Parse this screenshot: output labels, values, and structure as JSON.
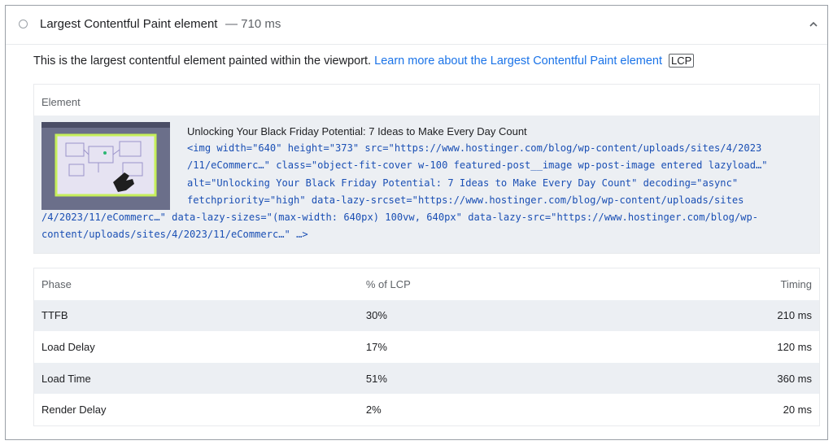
{
  "audit": {
    "title": "Largest Contentful Paint element",
    "value": "— 710 ms",
    "description_text": "This is the largest contentful element painted within the viewport.",
    "learn_more_link": "Learn more about the Largest Contentful Paint element",
    "badge": "LCP"
  },
  "element_table": {
    "header": "Element",
    "node_label": "Unlocking Your Black Friday Potential: 7 Ideas to Make Every Day Count",
    "snippet_lines": [
      "<img width=\"640\" height=\"373\" src=\"https://www.hostinger.com/blog/wp-content/uploads/sites/4/2023",
      "/11/eCommerc…\" class=\"object-fit-cover w-100 featured-post__image wp-post-image entered lazyload…\"",
      "alt=\"Unlocking Your Black Friday Potential: 7 Ideas to Make Every Day Count\" decoding=\"async\"",
      "fetchpriority=\"high\" data-lazy-srcset=\"https://www.hostinger.com/blog/wp-content/uploads/sites",
      "/4/2023/11/eCommerc…\" data-lazy-sizes=\"(max-width: 640px) 100vw, 640px\" data-lazy-src=\"https://www.hostinger.com/blog/wp-",
      "content/uploads/sites/4/2023/11/eCommerc…\" …>"
    ]
  },
  "phase_table": {
    "headers": [
      "Phase",
      "% of LCP",
      "Timing"
    ],
    "rows": [
      [
        "TTFB",
        "30%",
        "210 ms"
      ],
      [
        "Load Delay",
        "17%",
        "120 ms"
      ],
      [
        "Load Time",
        "51%",
        "360 ms"
      ],
      [
        "Render Delay",
        "2%",
        "20 ms"
      ]
    ]
  },
  "colors": {
    "link": "#1a73e8",
    "code": "#1a4fb4",
    "row_shade": "#eceff3",
    "thumbnail_border": "#c6ef5a",
    "thumbnail_bg": "#6b6f8a"
  },
  "icons": [
    "status-circle-icon",
    "chevron-up-icon",
    "pointing-hand-icon"
  ]
}
